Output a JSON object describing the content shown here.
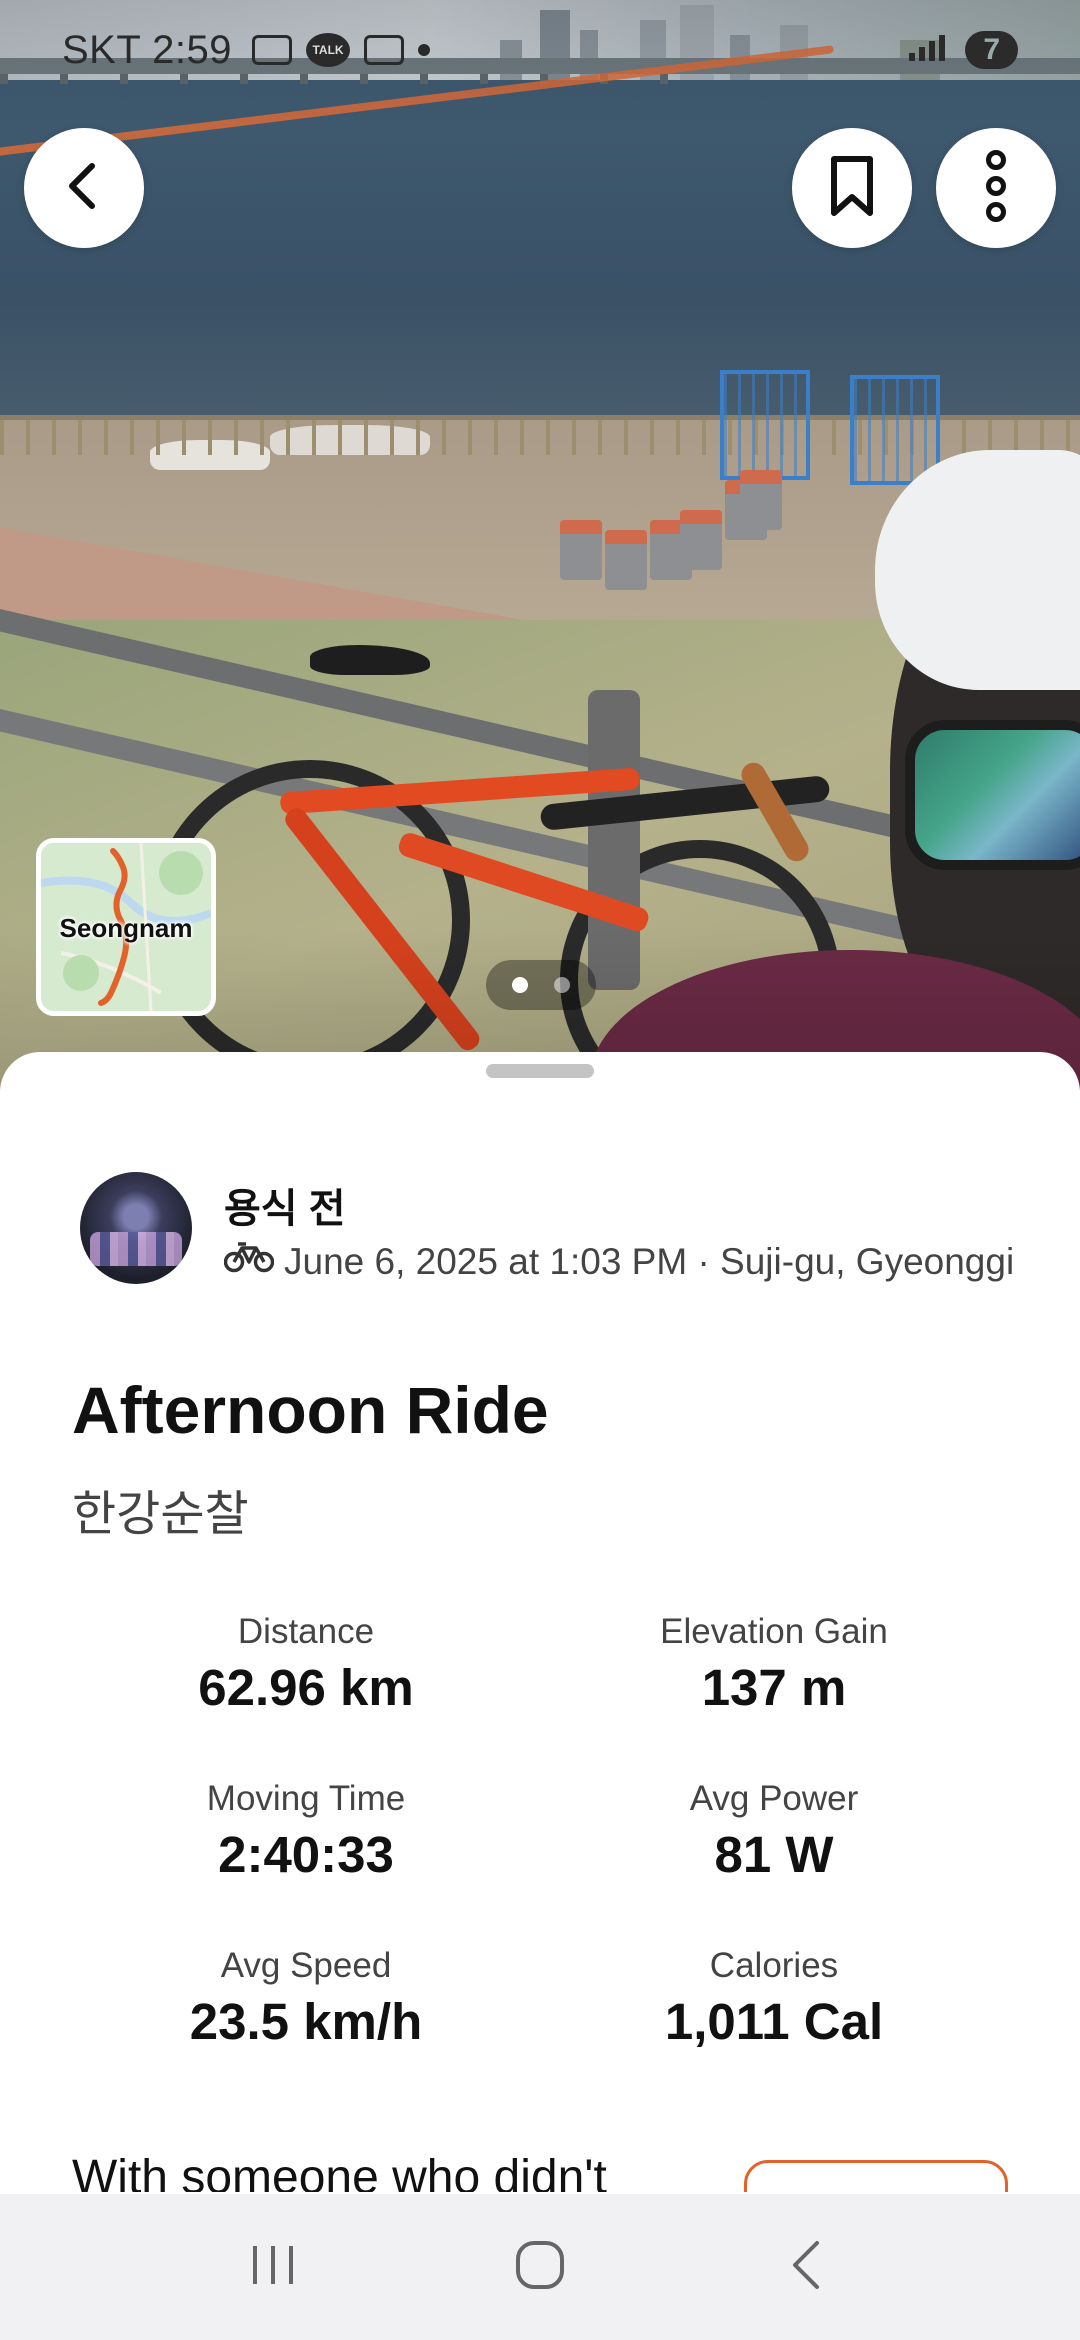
{
  "status_bar": {
    "carrier_time": "SKT 2:59",
    "talk_badge": "TALK",
    "battery_level": "7"
  },
  "hero": {
    "map_label": "Seongnam",
    "page_count": 2,
    "active_page": 1
  },
  "activity": {
    "athlete_name": "용식 전",
    "sport_icon": "bicycle-icon",
    "meta": "June 6, 2025 at 1:03 PM · Suji-gu, Gyeonggi",
    "title": "Afternoon Ride",
    "description": "한강순찰"
  },
  "stats": [
    {
      "label": "Distance",
      "value": "62.96 km"
    },
    {
      "label": "Elevation Gain",
      "value": "137 m"
    },
    {
      "label": "Moving Time",
      "value": "2:40:33"
    },
    {
      "label": "Avg Power",
      "value": "81 W"
    },
    {
      "label": "Avg Speed",
      "value": "23.5 km/h"
    },
    {
      "label": "Calories",
      "value": "1,011 Cal"
    }
  ],
  "teaser": {
    "text": "With someone who didn't"
  },
  "colors": {
    "accent": "#e2622b",
    "route": "#e2622b"
  },
  "nav": {
    "recents_icon": "recent-apps-icon",
    "home_icon": "home-icon",
    "back_icon": "back-icon"
  }
}
